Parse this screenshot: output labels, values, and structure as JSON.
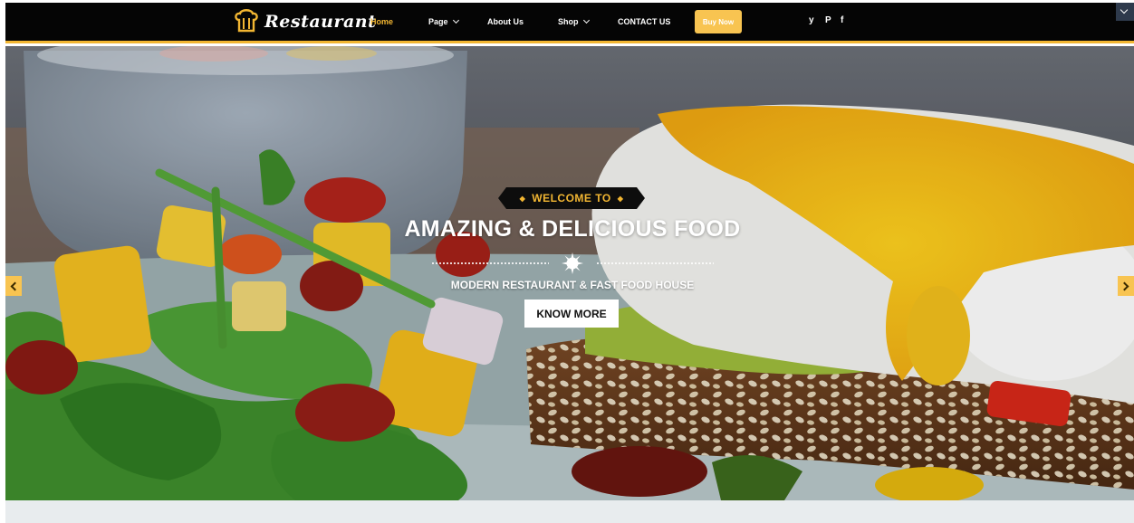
{
  "brand": {
    "name": "Restaurant",
    "logo_icon": "chef-hat-icon",
    "accent_color": "#f2b632"
  },
  "nav": {
    "items": [
      {
        "label": "Home",
        "active": true,
        "has_dropdown": false
      },
      {
        "label": "Page",
        "active": false,
        "has_dropdown": true
      },
      {
        "label": "About Us",
        "active": false,
        "has_dropdown": false
      },
      {
        "label": "Shop",
        "active": false,
        "has_dropdown": true
      },
      {
        "label": "CONTACT US",
        "active": false,
        "has_dropdown": false
      }
    ],
    "buy_button": "Buy Now",
    "social": [
      "y",
      "P",
      "f"
    ],
    "social_icons": [
      "twitter-icon",
      "pinterest-icon",
      "facebook-icon"
    ]
  },
  "hero": {
    "badge": "WELCOME TO",
    "headline": "AMAZING & DELICIOUS FOOD",
    "subheadline": "MODERN RESTAURANT & FAST FOOD HOUSE",
    "cta": "KNOW MORE",
    "prev_icon": "chevron-left-icon",
    "next_icon": "chevron-right-icon",
    "arrow_color": "#f8c451"
  }
}
